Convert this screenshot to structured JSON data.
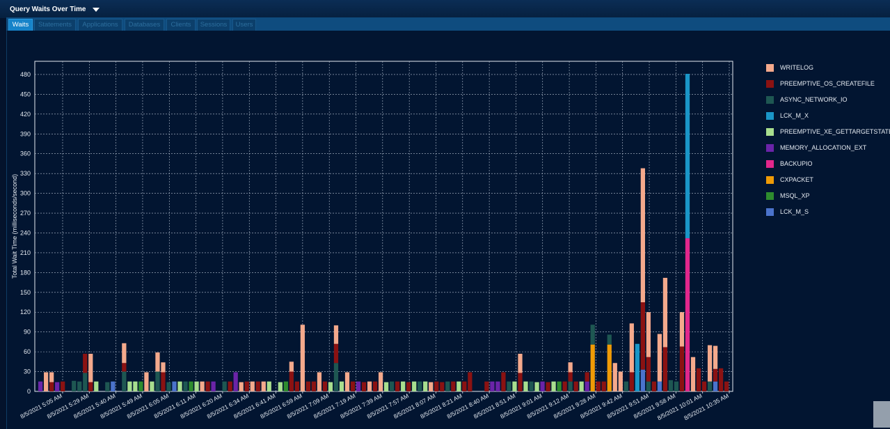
{
  "header": {
    "title": "Query Waits Over Time"
  },
  "tabs": [
    {
      "label": "Waits",
      "active": true
    },
    {
      "label": "Statements",
      "active": false
    },
    {
      "label": "Applications",
      "active": false
    },
    {
      "label": "Databases",
      "active": false
    },
    {
      "label": "Clients",
      "active": false
    },
    {
      "label": "Sessions",
      "active": false
    },
    {
      "label": "Users",
      "active": false
    }
  ],
  "colors": {
    "WRITELOG": "#f4a98c",
    "PREEMPTIVE_OS_CREATEFILE": "#8b1212",
    "ASYNC_NETWORK_IO": "#1e5752",
    "LCK_M_X": "#1a96c8",
    "PREEMPTIVE_XE_GETTARGETSTATE": "#a8de8e",
    "MEMORY_ALLOCATION_EXT": "#6b24a8",
    "BACKUPIO": "#e2278c",
    "CXPACKET": "#ef9b06",
    "MSQL_XP": "#2e8c2e",
    "LCK_M_S": "#4b73cc"
  },
  "chart_data": {
    "type": "bar",
    "stacked": true,
    "ylabel": "Total Wait Time (milliseconds/second)",
    "xlabel": "",
    "ylim": [
      0,
      500
    ],
    "yticks": [
      0,
      30,
      60,
      90,
      120,
      150,
      180,
      210,
      240,
      270,
      300,
      330,
      360,
      390,
      420,
      450,
      480
    ],
    "grid": true,
    "legend_position": "right",
    "x_tick_labels": [
      "8/5/2021 5:05 AM",
      "8/5/2021 5:29 AM",
      "8/5/2021 5:40 AM",
      "8/5/2021 5:49 AM",
      "8/5/2021 6:05 AM",
      "8/5/2021 6:11 AM",
      "8/5/2021 6:20 AM",
      "8/5/2021 6:34 AM",
      "8/5/2021 6:41 AM",
      "8/5/2021 6:59 AM",
      "8/5/2021 7:09 AM",
      "8/5/2021 7:19 AM",
      "8/5/2021 7:39 AM",
      "8/5/2021 7:57 AM",
      "8/5/2021 8:07 AM",
      "8/5/2021 8:21 AM",
      "8/5/2021 8:40 AM",
      "8/5/2021 8:51 AM",
      "8/5/2021 9:01 AM",
      "8/5/2021 9:12 AM",
      "8/5/2021 9:28 AM",
      "8/5/2021 9:42 AM",
      "8/5/2021 9:51 AM",
      "8/5/2021 9:58 AM",
      "8/5/2021 10:01 AM",
      "8/5/2021 10:35 AM"
    ],
    "series_names": [
      "WRITELOG",
      "PREEMPTIVE_OS_CREATEFILE",
      "ASYNC_NETWORK_IO",
      "LCK_M_X",
      "PREEMPTIVE_XE_GETTARGETSTATE",
      "MEMORY_ALLOCATION_EXT",
      "BACKUPIO",
      "CXPACKET",
      "MSQL_XP",
      "LCK_M_S"
    ],
    "bars": [
      {
        "MEMORY_ALLOCATION_EXT": 15
      },
      {
        "WRITELOG": 29
      },
      {
        "PREEMPTIVE_OS_CREATEFILE": 14,
        "WRITELOG": 15
      },
      {
        "MEMORY_ALLOCATION_EXT": 14
      },
      {
        "PREEMPTIVE_OS_CREATEFILE": 15
      },
      {},
      {
        "ASYNC_NETWORK_IO": 16
      },
      {
        "ASYNC_NETWORK_IO": 15
      },
      {
        "ASYNC_NETWORK_IO": 28,
        "PREEMPTIVE_OS_CREATEFILE": 29
      },
      {
        "PREEMPTIVE_OS_CREATEFILE": 14,
        "WRITELOG": 43
      },
      {
        "PREEMPTIVE_XE_GETTARGETSTATE": 15
      },
      {},
      {
        "ASYNC_NETWORK_IO": 14
      },
      {
        "LCK_M_S": 15
      },
      {},
      {
        "ASYNC_NETWORK_IO": 30,
        "PREEMPTIVE_OS_CREATEFILE": 13,
        "WRITELOG": 30
      },
      {
        "PREEMPTIVE_XE_GETTARGETSTATE": 15
      },
      {
        "PREEMPTIVE_XE_GETTARGETSTATE": 15
      },
      {
        "MSQL_XP": 15
      },
      {
        "WRITELOG": 29
      },
      {
        "PREEMPTIVE_XE_GETTARGETSTATE": 15
      },
      {
        "ASYNC_NETWORK_IO": 30,
        "WRITELOG": 29
      },
      {
        "PREEMPTIVE_OS_CREATEFILE": 29,
        "WRITELOG": 15
      },
      {
        "ASYNC_NETWORK_IO": 14
      },
      {
        "LCK_M_S": 15
      },
      {
        "PREEMPTIVE_XE_GETTARGETSTATE": 15
      },
      {
        "ASYNC_NETWORK_IO": 15
      },
      {
        "MSQL_XP": 15
      },
      {
        "PREEMPTIVE_XE_GETTARGETSTATE": 15
      },
      {
        "WRITELOG": 15
      },
      {
        "PREEMPTIVE_OS_CREATEFILE": 15
      },
      {
        "MEMORY_ALLOCATION_EXT": 15
      },
      {},
      {
        "ASYNC_NETWORK_IO": 15
      },
      {
        "PREEMPTIVE_OS_CREATEFILE": 15
      },
      {
        "MEMORY_ALLOCATION_EXT": 29
      },
      {
        "WRITELOG": 14
      },
      {
        "PREEMPTIVE_OS_CREATEFILE": 15
      },
      {
        "WRITELOG": 15
      },
      {
        "PREEMPTIVE_OS_CREATEFILE": 15
      },
      {
        "WRITELOG": 15
      },
      {
        "PREEMPTIVE_XE_GETTARGETSTATE": 15
      },
      {},
      {
        "PREEMPTIVE_XE_GETTARGETSTATE": 14
      },
      {
        "MSQL_XP": 15
      },
      {
        "PREEMPTIVE_OS_CREATEFILE": 30,
        "WRITELOG": 15
      },
      {
        "PREEMPTIVE_OS_CREATEFILE": 15
      },
      {
        "WRITELOG": 101
      },
      {
        "PREEMPTIVE_OS_CREATEFILE": 15
      },
      {
        "PREEMPTIVE_OS_CREATEFILE": 15
      },
      {
        "WRITELOG": 29
      },
      {
        "PREEMPTIVE_OS_CREATEFILE": 15
      },
      {
        "PREEMPTIVE_XE_GETTARGETSTATE": 14
      },
      {
        "ASYNC_NETWORK_IO": 43,
        "PREEMPTIVE_OS_CREATEFILE": 29,
        "WRITELOG": 28
      },
      {
        "PREEMPTIVE_XE_GETTARGETSTATE": 15
      },
      {
        "WRITELOG": 29
      },
      {
        "PREEMPTIVE_OS_CREATEFILE": 15
      },
      {
        "MEMORY_ALLOCATION_EXT": 15
      },
      {
        "PREEMPTIVE_OS_CREATEFILE": 14
      },
      {
        "WRITELOG": 15
      },
      {
        "PREEMPTIVE_OS_CREATEFILE": 15
      },
      {
        "WRITELOG": 29
      },
      {
        "PREEMPTIVE_XE_GETTARGETSTATE": 14
      },
      {
        "ASYNC_NETWORK_IO": 15
      },
      {
        "PREEMPTIVE_OS_CREATEFILE": 15
      },
      {
        "PREEMPTIVE_XE_GETTARGETSTATE": 15
      },
      {
        "PREEMPTIVE_OS_CREATEFILE": 14
      },
      {
        "PREEMPTIVE_XE_GETTARGETSTATE": 15
      },
      {
        "ASYNC_NETWORK_IO": 15
      },
      {
        "PREEMPTIVE_XE_GETTARGETSTATE": 15
      },
      {
        "WRITELOG": 14
      },
      {
        "PREEMPTIVE_OS_CREATEFILE": 15
      },
      {
        "PREEMPTIVE_OS_CREATEFILE": 14
      },
      {
        "ASYNC_NETWORK_IO": 15
      },
      {
        "PREEMPTIVE_OS_CREATEFILE": 15
      },
      {
        "PREEMPTIVE_XE_GETTARGETSTATE": 15
      },
      {
        "PREEMPTIVE_OS_CREATEFILE": 15
      },
      {
        "PREEMPTIVE_OS_CREATEFILE": 29
      },
      {},
      {},
      {
        "PREEMPTIVE_OS_CREATEFILE": 15
      },
      {
        "MEMORY_ALLOCATION_EXT": 15
      },
      {
        "MEMORY_ALLOCATION_EXT": 15
      },
      {
        "PREEMPTIVE_OS_CREATEFILE": 29
      },
      {
        "ASYNC_NETWORK_IO": 15
      },
      {
        "PREEMPTIVE_XE_GETTARGETSTATE": 15
      },
      {
        "PREEMPTIVE_OS_CREATEFILE": 28,
        "WRITELOG": 29
      },
      {
        "PREEMPTIVE_XE_GETTARGETSTATE": 15
      },
      {
        "ASYNC_NETWORK_IO": 15
      },
      {
        "PREEMPTIVE_XE_GETTARGETSTATE": 14
      },
      {
        "MEMORY_ALLOCATION_EXT": 15
      },
      {
        "PREEMPTIVE_OS_CREATEFILE": 14
      },
      {
        "PREEMPTIVE_XE_GETTARGETSTATE": 15
      },
      {
        "MSQL_XP": 15
      },
      {
        "PREEMPTIVE_OS_CREATEFILE": 15
      },
      {
        "WRITELOG": 15,
        "PREEMPTIVE_OS_CREATEFILE": 14,
        "ASYNC_NETWORK_IO": 15
      },
      {
        "PREEMPTIVE_OS_CREATEFILE": 15
      },
      {
        "PREEMPTIVE_XE_GETTARGETSTATE": 15
      },
      {
        "MEMORY_ALLOCATION_EXT": 15,
        "PREEMPTIVE_OS_CREATEFILE": 14
      },
      {
        "CXPACKET": 71,
        "ASYNC_NETWORK_IO": 30
      },
      {
        "PREEMPTIVE_OS_CREATEFILE": 15
      },
      {
        "PREEMPTIVE_OS_CREATEFILE": 15
      },
      {
        "CXPACKET": 71,
        "ASYNC_NETWORK_IO": 15
      },
      {
        "WRITELOG": 43
      },
      {
        "WRITELOG": 30
      },
      {
        "ASYNC_NETWORK_IO": 15
      },
      {
        "PREEMPTIVE_OS_CREATEFILE": 29,
        "WRITELOG": 74
      },
      {
        "LCK_M_X": 72
      },
      {
        "LCK_M_S": 33,
        "PREEMPTIVE_OS_CREATEFILE": 102,
        "WRITELOG": 203
      },
      {
        "ASYNC_NETWORK_IO": 15,
        "PREEMPTIVE_OS_CREATEFILE": 37,
        "WRITELOG": 68
      },
      {
        "PREEMPTIVE_OS_CREATEFILE": 15
      },
      {
        "LCK_M_S": 15,
        "WRITELOG": 72
      },
      {
        "PREEMPTIVE_OS_CREATEFILE": 67,
        "WRITELOG": 105
      },
      {
        "ASYNC_NETWORK_IO": 17
      },
      {
        "ASYNC_NETWORK_IO": 15
      },
      {
        "PREEMPTIVE_OS_CREATEFILE": 68,
        "WRITELOG": 52
      },
      {
        "BACKUPIO": 232,
        "LCK_M_X": 249
      },
      {
        "WRITELOG": 52
      },
      {
        "PREEMPTIVE_OS_CREATEFILE": 35
      },
      {
        "PREEMPTIVE_OS_CREATEFILE": 15
      },
      {
        "ASYNC_NETWORK_IO": 15,
        "WRITELOG": 55
      },
      {
        "LCK_M_S": 15,
        "PREEMPTIVE_OS_CREATEFILE": 19,
        "WRITELOG": 35
      },
      {
        "PREEMPTIVE_OS_CREATEFILE": 35
      },
      {
        "PREEMPTIVE_OS_CREATEFILE": 15
      }
    ]
  }
}
